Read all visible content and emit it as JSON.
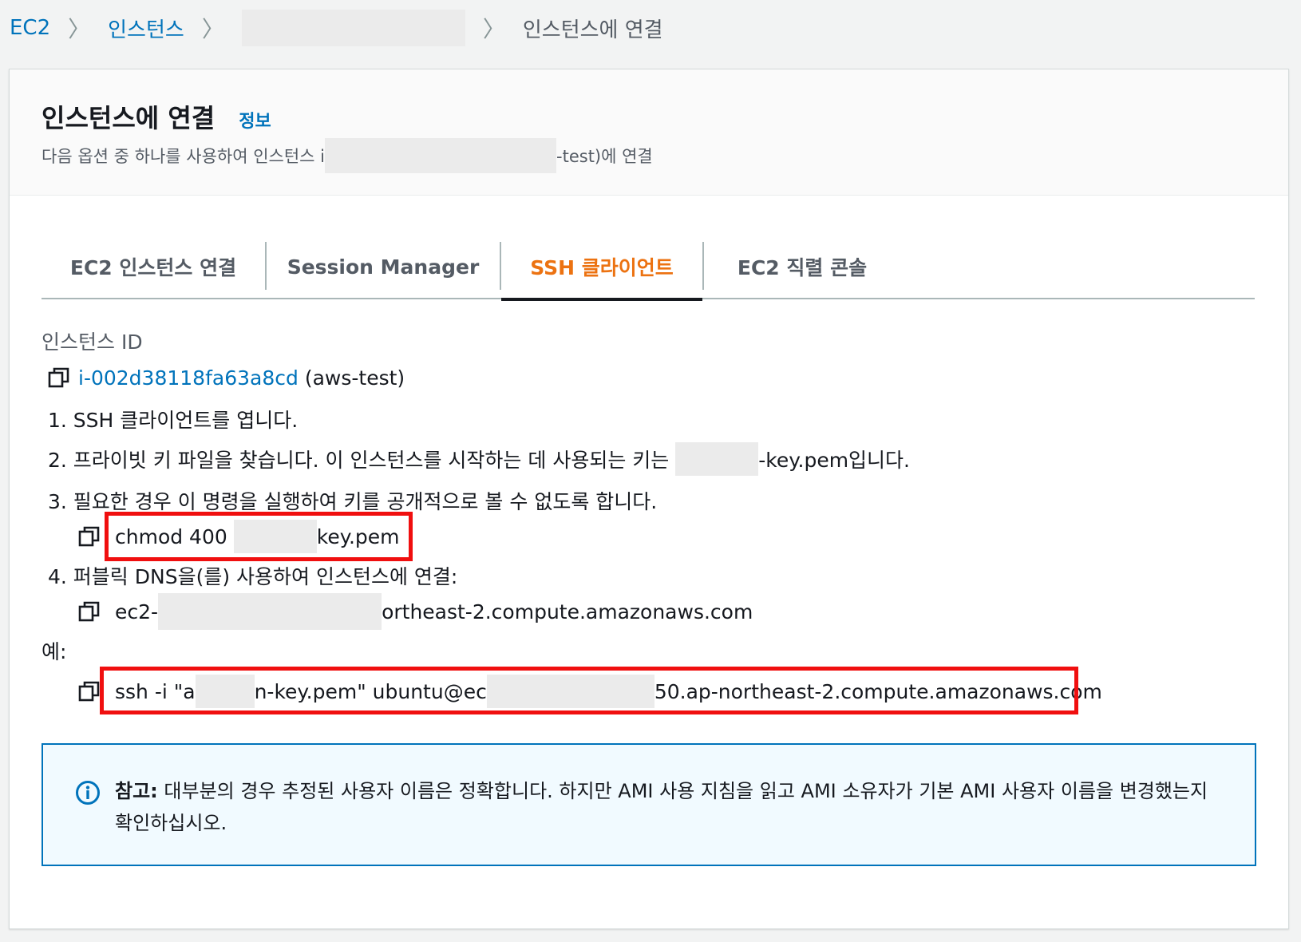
{
  "breadcrumb": {
    "items": [
      "EC2",
      "인스턴스"
    ],
    "current": "인스턴스에 연결"
  },
  "header": {
    "title": "인스턴스에 연결",
    "info_link": "정보",
    "subtitle_prefix": "다음 옵션 중 하나를 사용하여 인스턴스 i",
    "subtitle_suffix": "-test)에 연결"
  },
  "tabs": [
    {
      "label": "EC2 인스턴스 연결",
      "active": false
    },
    {
      "label": "Session Manager",
      "active": false
    },
    {
      "label": "SSH 클라이언트",
      "active": true
    },
    {
      "label": "EC2 직렬 콘솔",
      "active": false
    }
  ],
  "instance": {
    "label": "인스턴스 ID",
    "id": "i-002d38118fa63a8cd",
    "name": "(aws-test)"
  },
  "steps": {
    "step1": "1. SSH 클라이언트를 엽니다.",
    "step2_prefix": "2. 프라이빗 키 파일을 찾습니다. 이 인스턴스를 시작하는 데 사용되는 키는",
    "step2_suffix": "-key.pem입니다.",
    "step3": "3. 필요한 경우 이 명령을 실행하여 키를 공개적으로 볼 수 없도록 합니다.",
    "chmod_prefix": "chmod 400",
    "chmod_suffix": "key.pem",
    "step4": "4. 퍼블릭 DNS을(를) 사용하여 인스턴스에 연결:",
    "dns_prefix": "ec2-",
    "dns_suffix": "ortheast-2.compute.amazonaws.com",
    "example_label": "예:",
    "ssh_prefix": "ssh -i \"a",
    "ssh_mid": "n-key.pem\" ubuntu@ec",
    "ssh_suffix": "50.ap-northeast-2.compute.amazonaws.com"
  },
  "note": {
    "label": "참고:",
    "text": "대부분의 경우 추정된 사용자 이름은 정확합니다. 하지만 AMI 사용 지침을 읽고 AMI 소유자가 기본 AMI 사용자 이름을 변경했는지 확인하십시오."
  },
  "colors": {
    "link": "#0073bb",
    "active_tab": "#ec7211",
    "highlight": "#f00f0f"
  }
}
